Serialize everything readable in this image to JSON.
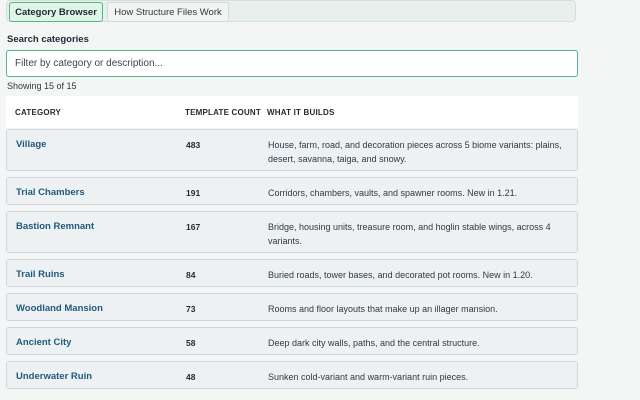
{
  "tabs": [
    {
      "label": "Category Browser",
      "active": true
    },
    {
      "label": "How Structure Files Work",
      "active": false
    }
  ],
  "search": {
    "label": "Search categories",
    "placeholder": "Filter by category or description..."
  },
  "results": {
    "count_text": "Showing 15 of 15"
  },
  "table": {
    "headers": {
      "category": "CATEGORY",
      "count": "TEMPLATE COUNT",
      "what": "WHAT IT BUILDS"
    },
    "rows": [
      {
        "name": "Village",
        "count": "483",
        "description": "House, farm, road, and decoration pieces across 5 biome variants: plains, desert, savanna, taiga, and snowy."
      },
      {
        "name": "Trial Chambers",
        "count": "191",
        "description": "Corridors, chambers, vaults, and spawner rooms. New in 1.21."
      },
      {
        "name": "Bastion Remnant",
        "count": "167",
        "description": "Bridge, housing units, treasure room, and hoglin stable wings, across 4 variants."
      },
      {
        "name": "Trail Ruins",
        "count": "84",
        "description": "Buried roads, tower bases, and decorated pot rooms. New in 1.20."
      },
      {
        "name": "Woodland Mansion",
        "count": "73",
        "description": "Rooms and floor layouts that make up an illager mansion."
      },
      {
        "name": "Ancient City",
        "count": "58",
        "description": "Deep dark city walls, paths, and the central structure."
      },
      {
        "name": "Underwater Ruin",
        "count": "48",
        "description": "Sunken cold-variant and warm-variant ruin pieces."
      }
    ]
  },
  "colors": {
    "accent": "#52b788",
    "link": "#1f5a7a",
    "row_bg": "#eef1f4"
  }
}
